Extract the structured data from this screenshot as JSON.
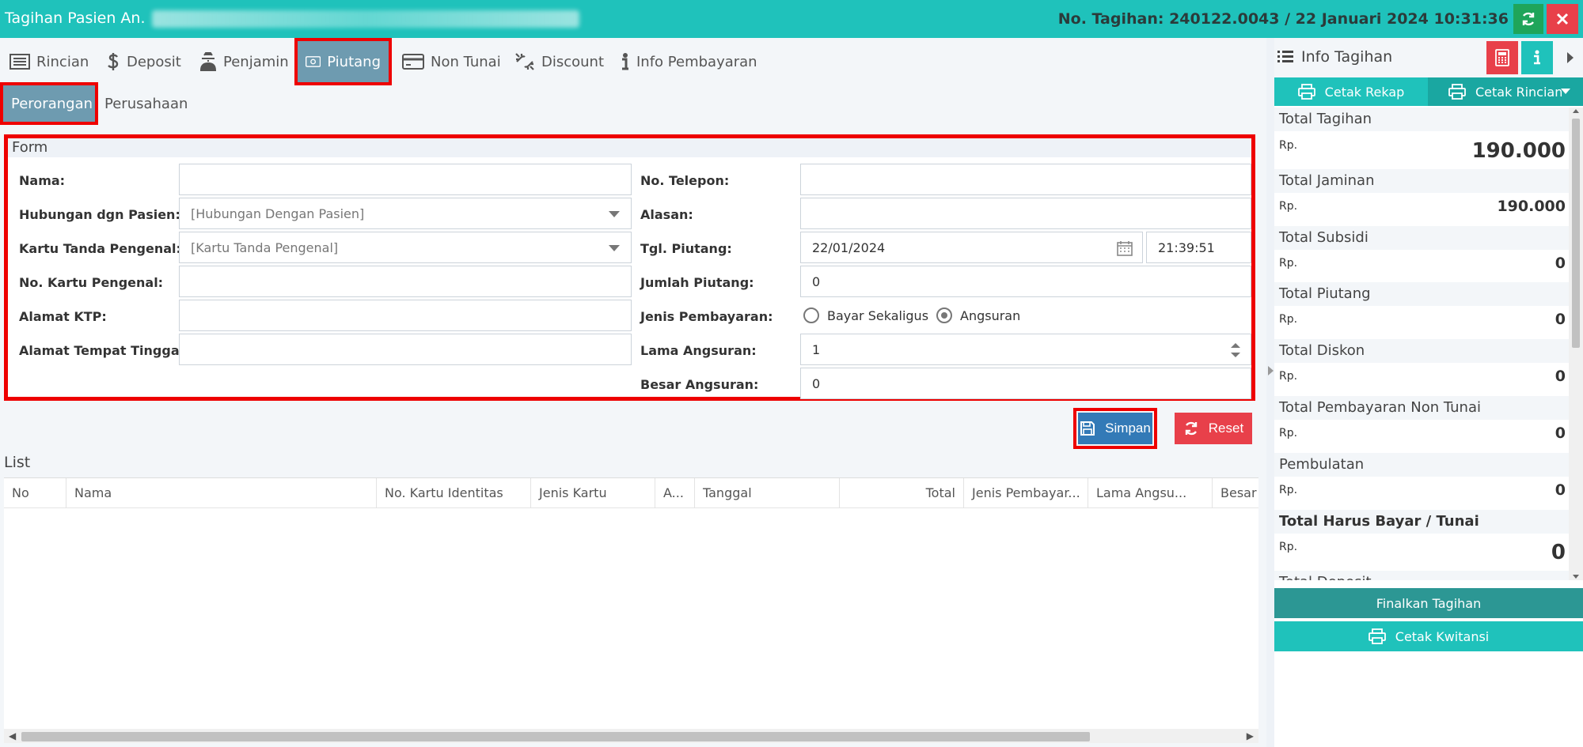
{
  "window": {
    "title": "Tagihan Pasien An.",
    "bill_info": "No. Tagihan: 240122.0043 / 22 Januari 2024 10:31:36"
  },
  "tabs": [
    {
      "label": "Rincian",
      "icon": "list-icon"
    },
    {
      "label": "Deposit",
      "icon": "dollar-icon"
    },
    {
      "label": "Penjamin",
      "icon": "user-secret-icon"
    },
    {
      "label": "Piutang",
      "icon": "money-bill-icon"
    },
    {
      "label": "Non Tunai",
      "icon": "credit-card-icon"
    },
    {
      "label": "Discount",
      "icon": "chain-broken-icon"
    },
    {
      "label": "Info Pembayaran",
      "icon": "info-icon"
    }
  ],
  "subtabs": [
    {
      "label": "Perorangan"
    },
    {
      "label": "Perusahaan"
    }
  ],
  "form": {
    "heading": "Form",
    "left": {
      "nama_label": "Nama:",
      "nama_value": "",
      "hubungan_label": "Hubungan dgn Pasien:",
      "hubungan_value": "[Hubungan Dengan Pasien]",
      "kartu_label": "Kartu Tanda Pengenal:",
      "kartu_value": "[Kartu Tanda Pengenal]",
      "no_kartu_label": "No. Kartu Pengenal:",
      "no_kartu_value": "",
      "alamat_ktp_label": "Alamat KTP:",
      "alamat_ktp_value": "",
      "alamat_tinggal_label": "Alamat Tempat Tinggal:",
      "alamat_tinggal_value": ""
    },
    "right": {
      "telepon_label": "No. Telepon:",
      "telepon_value": "",
      "alasan_label": "Alasan:",
      "alasan_value": "",
      "tgl_label": "Tgl. Piutang:",
      "tgl_value": "22/01/2024",
      "time_value": "21:39:51",
      "jumlah_label": "Jumlah Piutang:",
      "jumlah_value": "0",
      "jenis_label": "Jenis Pembayaran:",
      "opt_sekaligus": "Bayar Sekaligus",
      "opt_angsuran": "Angsuran",
      "lama_label": "Lama Angsuran:",
      "lama_value": "1",
      "besar_label": "Besar Angsuran:",
      "besar_value": "0"
    }
  },
  "actions": {
    "save": "Simpan",
    "reset": "Reset"
  },
  "list": {
    "heading": "List",
    "columns": [
      "No",
      "Nama",
      "No. Kartu Identitas",
      "Jenis Kartu",
      "A...",
      "Tanggal",
      "Total",
      "Jenis Pembayar...",
      "Lama Angsu...",
      "Besar A"
    ]
  },
  "panel": {
    "title": "Info Tagihan",
    "cetak_rekap": "Cetak Rekap",
    "cetak_rincian": "Cetak Rincian",
    "currency": "Rp.",
    "items": [
      {
        "label": "Total Tagihan",
        "value": "190.000"
      },
      {
        "label": "Total Jaminan",
        "value": "190.000"
      },
      {
        "label": "Total Subsidi",
        "value": "0"
      },
      {
        "label": "Total Piutang",
        "value": "0"
      },
      {
        "label": "Total Diskon",
        "value": "0"
      },
      {
        "label": "Total Pembayaran Non Tunai",
        "value": "0"
      },
      {
        "label": "Pembulatan",
        "value": "0"
      },
      {
        "label": "Total Harus Bayar / Tunai",
        "value": "0"
      },
      {
        "label": "Total Deposit",
        "value": ""
      }
    ],
    "finalkan": "Finalkan Tagihan",
    "kwitansi": "Cetak Kwitansi"
  },
  "colors": {
    "accent": "#1fc2bb",
    "tab_active": "#6e9bb0",
    "primary": "#337ab7",
    "danger": "#e8404a",
    "highlight": "#ee0000"
  }
}
